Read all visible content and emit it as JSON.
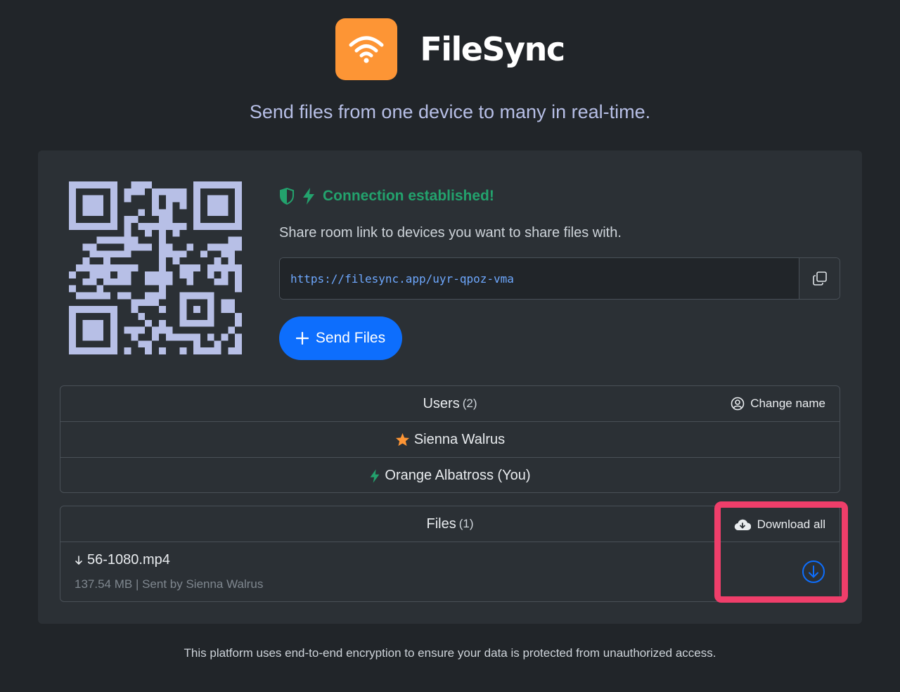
{
  "app": {
    "title": "FileSync",
    "tagline": "Send files from one device to many in real-time.",
    "brand_color": "#fd9535"
  },
  "connection": {
    "status": "Connection established!",
    "status_color": "#23a26d",
    "share_prompt": "Share room link to devices you want to share files with.",
    "room_link": "https://filesync.app/uyr-qpoz-vma",
    "send_button": "Send Files"
  },
  "users": {
    "header": "Users",
    "count": "(2)",
    "change_name": "Change name",
    "items": [
      {
        "name": "Sienna Walrus",
        "icon": "star-icon"
      },
      {
        "name": "Orange Albatross (You)",
        "icon": "bolt-icon"
      }
    ]
  },
  "files": {
    "header": "Files",
    "count": "(1)",
    "download_all": "Download all",
    "items": [
      {
        "name": "56-1080.mp4",
        "meta": "137.54 MB | Sent by Sienna Walrus"
      }
    ]
  },
  "footer": "This platform uses end-to-end encryption to ensure your data is protected from unauthorized access.",
  "highlight_color": "#ef3e6a"
}
